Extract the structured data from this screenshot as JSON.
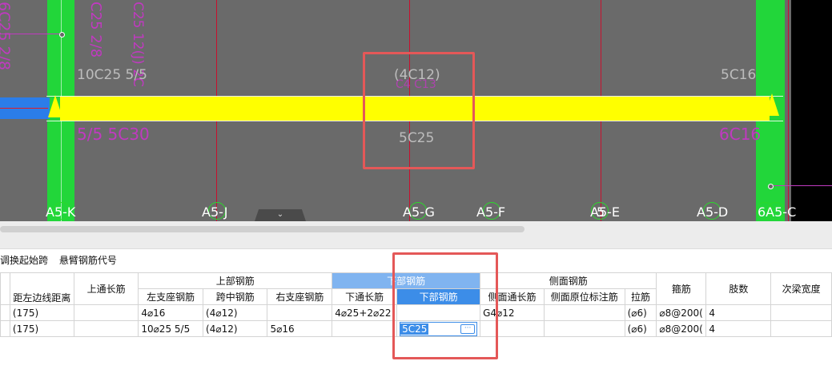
{
  "canvas": {
    "labels": {
      "top_left": "10C25 5/5",
      "top_center": "(4C12)",
      "bottom_center": "5C25",
      "top_right": "5C16",
      "mag_left_top": "C25 2/8",
      "mag_left_bottom": "5/5 5C30",
      "mag_right": "6C16",
      "mag_vertical_left": "6C25 2/8",
      "mag_vertical_mid": "C25 12(J) 2C",
      "mag_mid": "C4 C13"
    },
    "axes": [
      "A5-K",
      "A5-J",
      "A5-G",
      "A5-F",
      "A5-E",
      "A5-D",
      "6A5-C"
    ],
    "axis_extra": "5",
    "collapse_icon": "chevron-down-icon"
  },
  "toolbar": {
    "items": [
      "调换起始跨",
      "悬臂钢筋代号"
    ]
  },
  "table": {
    "group_headers": {
      "top": "上部钢筋",
      "bottom": "下部钢筋",
      "side": "侧面钢筋"
    },
    "columns": {
      "edge_distance": "距左边线距离",
      "top_through": "上通长筋",
      "left_support": "左支座钢筋",
      "mid_span": "跨中钢筋",
      "right_support": "右支座钢筋",
      "bottom_through": "下通长筋",
      "bottom_bar": "下部钢筋",
      "side_through": "侧面通长筋",
      "side_marked": "侧面原位标注筋",
      "tie": "拉筋",
      "stirrup": "箍筋",
      "legs": "肢数",
      "secondary_width": "次梁宽度"
    },
    "rows": [
      {
        "edge_distance": "(175)",
        "top_through": "",
        "left_support": "4⌀16",
        "mid_span": "(4⌀12)",
        "right_support": "",
        "bottom_through": "4⌀25+2⌀22",
        "bottom_bar": "",
        "side_through": "G4⌀12",
        "side_marked": "",
        "tie": "(⌀6)",
        "stirrup": "⌀8@200(",
        "legs": "4",
        "secondary_width": ""
      },
      {
        "edge_distance": "(175)",
        "top_through": "",
        "left_support": "10⌀25 5/5",
        "mid_span": "(4⌀12)",
        "right_support": "5⌀16",
        "bottom_through": "",
        "bottom_bar": "5C25",
        "side_through": "",
        "side_marked": "",
        "tie": "(⌀6)",
        "stirrup": "⌀8@200(",
        "legs": "4",
        "secondary_width": ""
      }
    ],
    "edit_button": "···"
  }
}
